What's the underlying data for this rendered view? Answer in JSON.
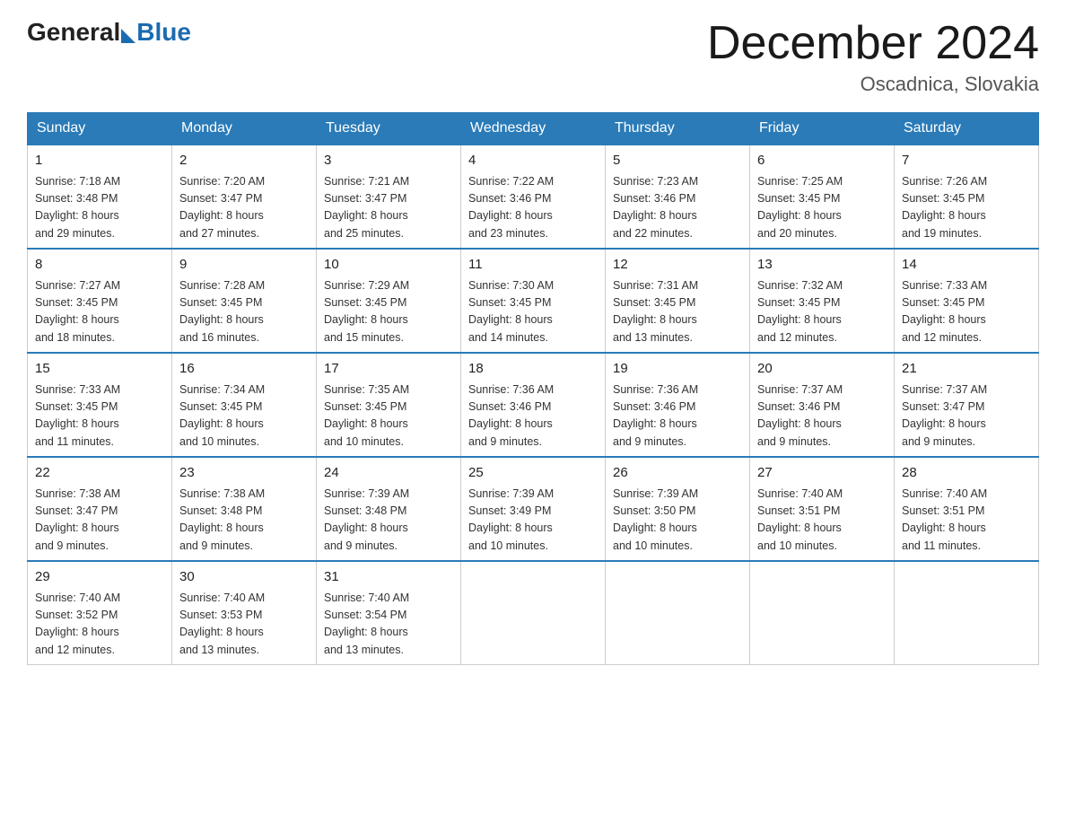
{
  "header": {
    "logo_general": "General",
    "logo_blue": "Blue",
    "title": "December 2024",
    "location": "Oscadnica, Slovakia"
  },
  "weekdays": [
    "Sunday",
    "Monday",
    "Tuesday",
    "Wednesday",
    "Thursday",
    "Friday",
    "Saturday"
  ],
  "weeks": [
    [
      {
        "day": "1",
        "sunrise": "7:18 AM",
        "sunset": "3:48 PM",
        "daylight": "8 hours and 29 minutes."
      },
      {
        "day": "2",
        "sunrise": "7:20 AM",
        "sunset": "3:47 PM",
        "daylight": "8 hours and 27 minutes."
      },
      {
        "day": "3",
        "sunrise": "7:21 AM",
        "sunset": "3:47 PM",
        "daylight": "8 hours and 25 minutes."
      },
      {
        "day": "4",
        "sunrise": "7:22 AM",
        "sunset": "3:46 PM",
        "daylight": "8 hours and 23 minutes."
      },
      {
        "day": "5",
        "sunrise": "7:23 AM",
        "sunset": "3:46 PM",
        "daylight": "8 hours and 22 minutes."
      },
      {
        "day": "6",
        "sunrise": "7:25 AM",
        "sunset": "3:45 PM",
        "daylight": "8 hours and 20 minutes."
      },
      {
        "day": "7",
        "sunrise": "7:26 AM",
        "sunset": "3:45 PM",
        "daylight": "8 hours and 19 minutes."
      }
    ],
    [
      {
        "day": "8",
        "sunrise": "7:27 AM",
        "sunset": "3:45 PM",
        "daylight": "8 hours and 18 minutes."
      },
      {
        "day": "9",
        "sunrise": "7:28 AM",
        "sunset": "3:45 PM",
        "daylight": "8 hours and 16 minutes."
      },
      {
        "day": "10",
        "sunrise": "7:29 AM",
        "sunset": "3:45 PM",
        "daylight": "8 hours and 15 minutes."
      },
      {
        "day": "11",
        "sunrise": "7:30 AM",
        "sunset": "3:45 PM",
        "daylight": "8 hours and 14 minutes."
      },
      {
        "day": "12",
        "sunrise": "7:31 AM",
        "sunset": "3:45 PM",
        "daylight": "8 hours and 13 minutes."
      },
      {
        "day": "13",
        "sunrise": "7:32 AM",
        "sunset": "3:45 PM",
        "daylight": "8 hours and 12 minutes."
      },
      {
        "day": "14",
        "sunrise": "7:33 AM",
        "sunset": "3:45 PM",
        "daylight": "8 hours and 12 minutes."
      }
    ],
    [
      {
        "day": "15",
        "sunrise": "7:33 AM",
        "sunset": "3:45 PM",
        "daylight": "8 hours and 11 minutes."
      },
      {
        "day": "16",
        "sunrise": "7:34 AM",
        "sunset": "3:45 PM",
        "daylight": "8 hours and 10 minutes."
      },
      {
        "day": "17",
        "sunrise": "7:35 AM",
        "sunset": "3:45 PM",
        "daylight": "8 hours and 10 minutes."
      },
      {
        "day": "18",
        "sunrise": "7:36 AM",
        "sunset": "3:46 PM",
        "daylight": "8 hours and 9 minutes."
      },
      {
        "day": "19",
        "sunrise": "7:36 AM",
        "sunset": "3:46 PM",
        "daylight": "8 hours and 9 minutes."
      },
      {
        "day": "20",
        "sunrise": "7:37 AM",
        "sunset": "3:46 PM",
        "daylight": "8 hours and 9 minutes."
      },
      {
        "day": "21",
        "sunrise": "7:37 AM",
        "sunset": "3:47 PM",
        "daylight": "8 hours and 9 minutes."
      }
    ],
    [
      {
        "day": "22",
        "sunrise": "7:38 AM",
        "sunset": "3:47 PM",
        "daylight": "8 hours and 9 minutes."
      },
      {
        "day": "23",
        "sunrise": "7:38 AM",
        "sunset": "3:48 PM",
        "daylight": "8 hours and 9 minutes."
      },
      {
        "day": "24",
        "sunrise": "7:39 AM",
        "sunset": "3:48 PM",
        "daylight": "8 hours and 9 minutes."
      },
      {
        "day": "25",
        "sunrise": "7:39 AM",
        "sunset": "3:49 PM",
        "daylight": "8 hours and 10 minutes."
      },
      {
        "day": "26",
        "sunrise": "7:39 AM",
        "sunset": "3:50 PM",
        "daylight": "8 hours and 10 minutes."
      },
      {
        "day": "27",
        "sunrise": "7:40 AM",
        "sunset": "3:51 PM",
        "daylight": "8 hours and 10 minutes."
      },
      {
        "day": "28",
        "sunrise": "7:40 AM",
        "sunset": "3:51 PM",
        "daylight": "8 hours and 11 minutes."
      }
    ],
    [
      {
        "day": "29",
        "sunrise": "7:40 AM",
        "sunset": "3:52 PM",
        "daylight": "8 hours and 12 minutes."
      },
      {
        "day": "30",
        "sunrise": "7:40 AM",
        "sunset": "3:53 PM",
        "daylight": "8 hours and 13 minutes."
      },
      {
        "day": "31",
        "sunrise": "7:40 AM",
        "sunset": "3:54 PM",
        "daylight": "8 hours and 13 minutes."
      },
      null,
      null,
      null,
      null
    ]
  ],
  "labels": {
    "sunrise": "Sunrise:",
    "sunset": "Sunset:",
    "daylight": "Daylight:"
  }
}
